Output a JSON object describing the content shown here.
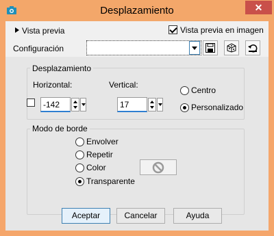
{
  "window": {
    "title": "Desplazamiento",
    "close_glyph": "✕"
  },
  "preview": {
    "label": "Vista previa",
    "image_preview_label": "Vista previa en imagen",
    "image_preview_checked": true
  },
  "config": {
    "label": "Configuración",
    "value": ""
  },
  "displacement": {
    "group_title": "Desplazamiento",
    "horizontal_label": "Horizontal:",
    "horizontal_value": "-142",
    "vertical_label": "Vertical:",
    "vertical_value": "17",
    "mode_centro": "Centro",
    "mode_personalizado": "Personalizado",
    "selected_mode": "Personalizado"
  },
  "border_mode": {
    "group_title": "Modo de borde",
    "options": [
      "Envolver",
      "Repetir",
      "Color",
      "Transparente"
    ],
    "selected": "Transparente"
  },
  "buttons": {
    "accept": "Aceptar",
    "cancel": "Cancelar",
    "help": "Ayuda"
  },
  "colors": {
    "title_bar": "#f3a76a",
    "close_button": "#c9504a",
    "focus_accent": "#2e7fd1"
  }
}
